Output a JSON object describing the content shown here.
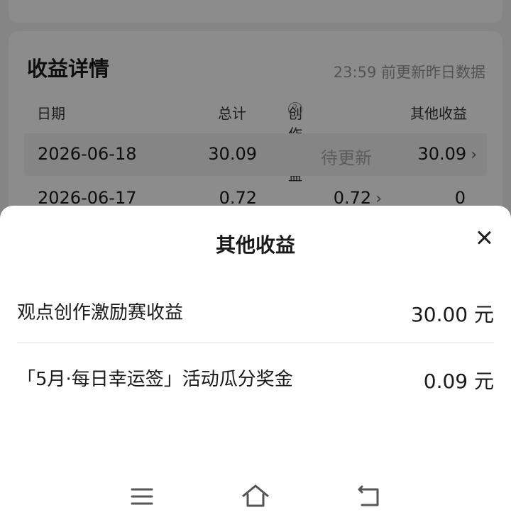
{
  "detail": {
    "title": "收益详情",
    "note": "23:59 前更新昨日数据",
    "headers": {
      "date": "日期",
      "total": "总计",
      "creation": "创作收益",
      "other": "其他收益"
    },
    "rows": [
      {
        "date": "2026-06-18",
        "total": "30.09",
        "creation": "待更新",
        "other": "30.09"
      },
      {
        "date": "2026-06-17",
        "total": "0.72",
        "creation": "0.72",
        "other": "0"
      }
    ]
  },
  "sheet": {
    "title": "其他收益",
    "items": [
      {
        "label": "观点创作激励赛收益",
        "value": "30.00 元"
      },
      {
        "label": "「5月·每日幸运签」活动瓜分奖金",
        "value": "0.09 元"
      }
    ]
  },
  "icons": {
    "help": "question-circle-icon",
    "close": "close-icon",
    "chevron": "chevron-right-icon",
    "nav_menu": "menu-icon",
    "nav_home": "home-icon",
    "nav_back": "back-icon"
  }
}
